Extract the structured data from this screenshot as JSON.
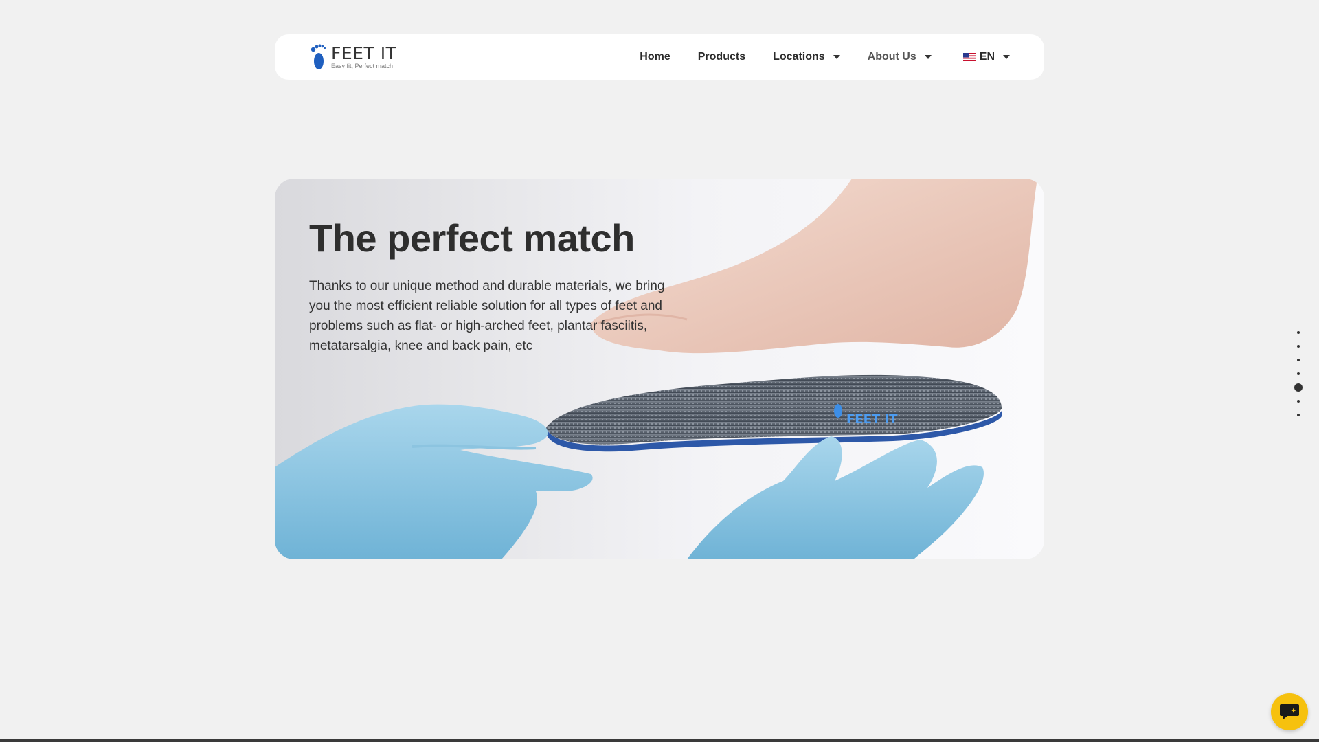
{
  "brand": {
    "name": "FEET IT",
    "tagline": "Easy fit, Perfect match",
    "color": "#1f5fbf"
  },
  "nav": {
    "items": [
      {
        "label": "Home",
        "has_dropdown": false
      },
      {
        "label": "Products",
        "has_dropdown": false
      },
      {
        "label": "Locations",
        "has_dropdown": true
      },
      {
        "label": "About Us",
        "has_dropdown": true
      }
    ],
    "language": {
      "label": "EN",
      "flag": "us-flag-icon"
    }
  },
  "hero": {
    "title": "The perfect match",
    "text": "Thanks to our unique method and durable materials, we bring you the most efficient reliable solution for all types of feet and problems such as flat- or high-arched feet, plantar fasciitis, metatarsalgia, knee and back pain, etc",
    "insole_print": "FEET IT"
  },
  "pagination": {
    "count": 7,
    "active_index": 4
  },
  "chat": {
    "icon": "chat-icon",
    "color": "#f6c10e"
  }
}
